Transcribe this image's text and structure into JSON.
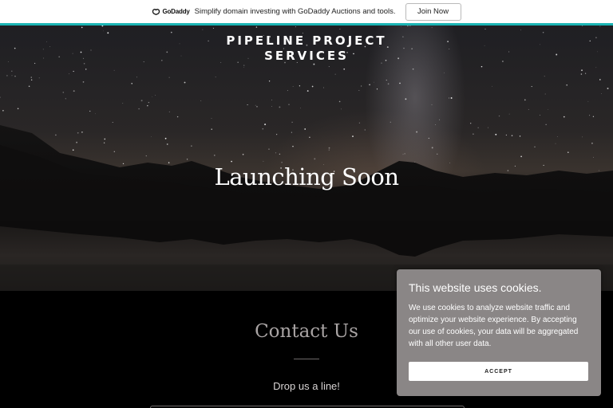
{
  "promo": {
    "logo_text": "GoDaddy",
    "message": "Simplify domain investing with GoDaddy Auctions and tools.",
    "button_label": "Join Now",
    "accent_color": "#1bb4b4"
  },
  "hero": {
    "brand_line1": "PIPELINE PROJECT",
    "brand_line2": "SERVICES",
    "headline": "Launching Soon"
  },
  "contact": {
    "title": "Contact Us",
    "subtitle": "Drop us a line!"
  },
  "cookie_banner": {
    "title": "This website uses cookies.",
    "body": "We use cookies to analyze website traffic and optimize your website experience. By accepting our use of cookies, your data will be aggregated with all other user data.",
    "accept_label": "ACCEPT",
    "background_color": "#8a8686"
  },
  "icons": {
    "godaddy_logo": "godaddy-logo-icon"
  }
}
